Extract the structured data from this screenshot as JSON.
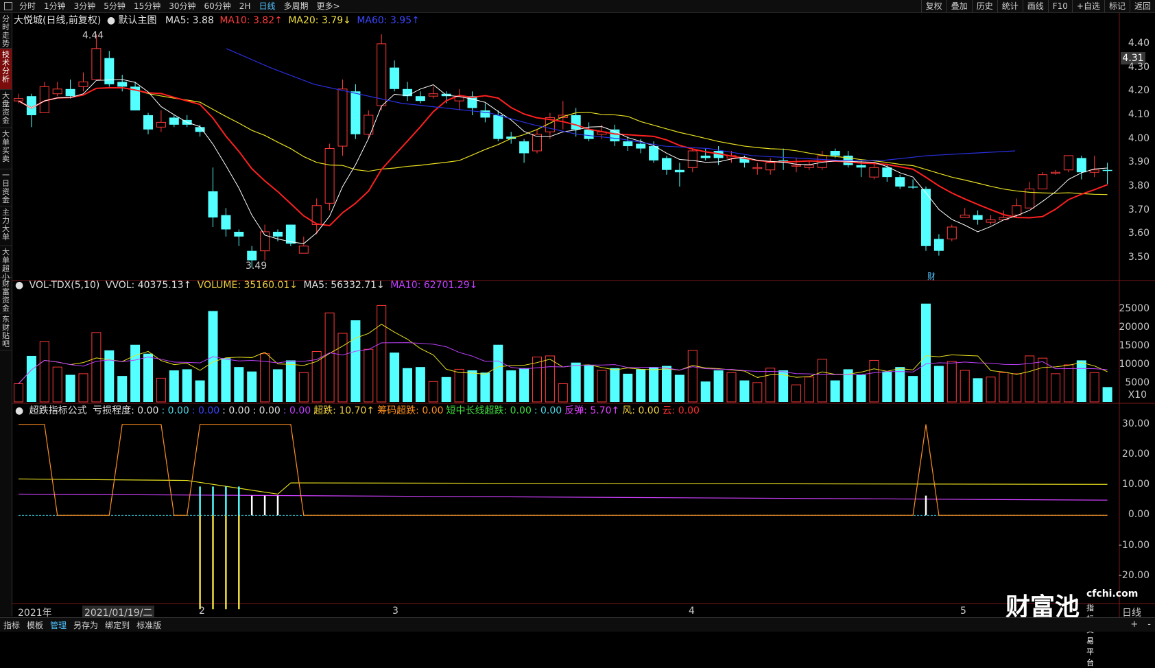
{
  "topbar": {
    "left_items": [
      "分时",
      "1分钟",
      "3分钟",
      "5分钟",
      "15分钟",
      "30分钟",
      "60分钟",
      "2H",
      "日线",
      "多周期",
      "更多>"
    ],
    "active": "日线",
    "right_items": [
      "复权",
      "叠加",
      "历史",
      "统计",
      "画线",
      "F10",
      "+自选",
      "标记",
      "返回"
    ]
  },
  "sidebar": [
    "分时走势",
    "技术分析",
    "大盘资金",
    "大单买卖",
    "一日资金",
    "主力大单",
    "大单超小",
    "财富资金",
    "东财贴吧"
  ],
  "sidebar_active": "技术分析",
  "main": {
    "name": "大悦城(日线,前复权)",
    "template": "默认主图",
    "ma5": "MA5: 3.88",
    "ma10": "MA10: 3.82↑",
    "ma20": "MA20: 3.79↓",
    "ma60": "MA60: 3.95↑",
    "high_label": "4.44",
    "low_label": "3.49",
    "price_tag": "4.31",
    "marker": "财",
    "y_ticks": [
      "4.40",
      "4.30",
      "4.20",
      "4.10",
      "4.00",
      "3.90",
      "3.80",
      "3.70",
      "3.60",
      "3.50"
    ]
  },
  "volume": {
    "title": "VOL-TDX(5,10)",
    "vvol": "VVOL: 40375.13↑",
    "volume": "VOLUME: 35160.01↓",
    "ma5": "MA5: 56332.71↓",
    "ma10": "MA10: 62701.29↓",
    "y_ticks": [
      "25000",
      "20000",
      "15000",
      "10000",
      "5000"
    ],
    "unit": "X10"
  },
  "indicator": {
    "title": "超跌指标公式",
    "parts": [
      {
        "text": "亏损程度: 0.00",
        "color": "#e0e0e0"
      },
      {
        "text": ": 0.00",
        "color": "#4fd8e8"
      },
      {
        "text": ": 0.00",
        "color": "#3a46ff"
      },
      {
        "text": ": 0.00",
        "color": "#e0e0e0"
      },
      {
        "text": ": 0.00",
        "color": "#e0e0e0"
      },
      {
        "text": ": 0.00",
        "color": "#c040ff"
      },
      {
        "text": "超跌: 10.70↑",
        "color": "#f0d040"
      },
      {
        "text": "筹码超跌: 0.00",
        "color": "#ff9020"
      },
      {
        "text": "短中长线超跌: 0.00",
        "color": "#40e040"
      },
      {
        "text": ": 0.00",
        "color": "#4fd8e8"
      },
      {
        "text": "反弹: 5.70↑",
        "color": "#e040ff"
      },
      {
        "text": "风: 0.00",
        "color": "#f0d040"
      },
      {
        "text": "云: 0.00",
        "color": "#ff3030"
      }
    ],
    "y_ticks": [
      "30.00",
      "20.00",
      "10.00",
      "0.00",
      "-10.00",
      "-20.00"
    ]
  },
  "dates": {
    "year": "2021年",
    "cursor": "2021/01/19/二",
    "m2": "2",
    "m3": "3",
    "m4": "4",
    "m5": "5",
    "label": "日线"
  },
  "bottombar": {
    "items": [
      "指标",
      "模板",
      "管理",
      "另存为",
      "绑定到",
      "标准版"
    ],
    "active": "管理",
    "right": [
      "+",
      "-"
    ]
  },
  "logo": {
    "brand": "财富池",
    "domain": "cfchi.com",
    "slogan": "指标交易平台"
  },
  "colors": {
    "up": "#ff3a3a",
    "down": "#54ffff",
    "ma5": "#ffffff",
    "ma10": "#ff2020",
    "ma20": "#e8e020",
    "ma60": "#2a30e0"
  },
  "chart_data": {
    "type": "candlestick",
    "candles": [
      [
        4.17,
        4.16,
        4.19,
        4.15,
        0
      ],
      [
        4.18,
        4.1,
        4.19,
        4.05,
        1
      ],
      [
        4.11,
        4.22,
        4.24,
        4.11,
        0
      ],
      [
        4.19,
        4.21,
        4.24,
        4.18,
        0
      ],
      [
        4.21,
        4.18,
        4.25,
        4.17,
        1
      ],
      [
        4.22,
        4.24,
        4.28,
        4.2,
        0
      ],
      [
        4.25,
        4.38,
        4.44,
        4.25,
        0
      ],
      [
        4.34,
        4.23,
        4.37,
        4.22,
        1
      ],
      [
        4.24,
        4.22,
        4.27,
        4.2,
        1
      ],
      [
        4.22,
        4.12,
        4.24,
        4.12,
        1
      ],
      [
        4.1,
        4.04,
        4.11,
        4.02,
        1
      ],
      [
        4.05,
        4.07,
        4.12,
        4.03,
        0
      ],
      [
        4.09,
        4.06,
        4.1,
        4.05,
        1
      ],
      [
        4.08,
        4.06,
        4.1,
        4.05,
        1
      ],
      [
        4.05,
        4.03,
        4.06,
        4.01,
        1
      ],
      [
        3.78,
        3.67,
        3.88,
        3.63,
        1
      ],
      [
        3.68,
        3.62,
        3.71,
        3.59,
        1
      ],
      [
        3.61,
        3.59,
        3.62,
        3.55,
        1
      ],
      [
        3.53,
        3.49,
        3.55,
        3.46,
        1
      ],
      [
        3.53,
        3.61,
        3.64,
        3.49,
        0
      ],
      [
        3.61,
        3.59,
        3.62,
        3.57,
        1
      ],
      [
        3.64,
        3.56,
        3.64,
        3.55,
        1
      ],
      [
        3.52,
        3.55,
        3.59,
        3.52,
        0
      ],
      [
        3.64,
        3.72,
        3.75,
        3.6,
        0
      ],
      [
        3.73,
        3.96,
        3.98,
        3.7,
        0
      ],
      [
        3.97,
        4.21,
        4.25,
        3.93,
        0
      ],
      [
        4.2,
        4.02,
        4.23,
        4.0,
        1
      ],
      [
        4.02,
        4.1,
        4.12,
        4.0,
        0
      ],
      [
        4.14,
        4.4,
        4.44,
        4.12,
        0
      ],
      [
        4.3,
        4.21,
        4.33,
        4.2,
        1
      ],
      [
        4.21,
        4.18,
        4.24,
        4.16,
        1
      ],
      [
        4.18,
        4.16,
        4.2,
        4.15,
        1
      ],
      [
        4.18,
        4.19,
        4.22,
        4.17,
        0
      ],
      [
        4.19,
        4.18,
        4.2,
        4.15,
        1
      ],
      [
        4.16,
        4.18,
        4.21,
        4.12,
        0
      ],
      [
        4.18,
        4.13,
        4.2,
        4.1,
        1
      ],
      [
        4.12,
        4.09,
        4.15,
        4.07,
        1
      ],
      [
        4.1,
        4.0,
        4.12,
        3.99,
        1
      ],
      [
        4.01,
        4.0,
        4.03,
        3.98,
        1
      ],
      [
        3.99,
        3.94,
        4.0,
        3.9,
        1
      ],
      [
        3.95,
        4.02,
        4.04,
        3.94,
        0
      ],
      [
        4.03,
        4.09,
        4.11,
        4.0,
        0
      ],
      [
        4.09,
        4.1,
        4.16,
        4.04,
        0
      ],
      [
        4.1,
        4.04,
        4.13,
        4.01,
        1
      ],
      [
        4.04,
        4.0,
        4.07,
        3.99,
        1
      ],
      [
        4.02,
        4.03,
        4.06,
        4.0,
        0
      ],
      [
        4.04,
        3.99,
        4.06,
        3.97,
        1
      ],
      [
        3.99,
        3.97,
        4.01,
        3.95,
        1
      ],
      [
        3.98,
        3.96,
        4.0,
        3.94,
        1
      ],
      [
        3.97,
        3.91,
        3.99,
        3.9,
        1
      ],
      [
        3.92,
        3.87,
        3.93,
        3.85,
        1
      ],
      [
        3.87,
        3.86,
        3.9,
        3.8,
        1
      ],
      [
        3.88,
        3.95,
        3.96,
        3.86,
        0
      ],
      [
        3.93,
        3.92,
        3.96,
        3.91,
        1
      ],
      [
        3.95,
        3.92,
        3.97,
        3.89,
        1
      ],
      [
        3.92,
        3.93,
        3.95,
        3.9,
        0
      ],
      [
        3.92,
        3.9,
        3.93,
        3.88,
        1
      ],
      [
        3.88,
        3.88,
        3.9,
        3.85,
        0
      ],
      [
        3.87,
        3.9,
        3.92,
        3.85,
        0
      ],
      [
        3.91,
        3.9,
        3.96,
        3.87,
        1
      ],
      [
        3.89,
        3.89,
        3.92,
        3.86,
        0
      ],
      [
        3.88,
        3.89,
        3.91,
        3.87,
        0
      ],
      [
        3.88,
        3.93,
        3.95,
        3.87,
        0
      ],
      [
        3.95,
        3.93,
        3.96,
        3.92,
        1
      ],
      [
        3.93,
        3.89,
        3.95,
        3.88,
        1
      ],
      [
        3.89,
        3.88,
        3.91,
        3.84,
        1
      ],
      [
        3.84,
        3.88,
        3.9,
        3.83,
        0
      ],
      [
        3.88,
        3.84,
        3.89,
        3.82,
        1
      ],
      [
        3.84,
        3.8,
        3.85,
        3.79,
        1
      ],
      [
        3.8,
        3.8,
        3.83,
        3.79,
        1
      ],
      [
        3.79,
        3.55,
        3.8,
        3.53,
        1
      ],
      [
        3.58,
        3.53,
        3.6,
        3.51,
        1
      ],
      [
        3.58,
        3.63,
        3.64,
        3.57,
        0
      ],
      [
        3.67,
        3.68,
        3.71,
        3.67,
        0
      ],
      [
        3.68,
        3.66,
        3.7,
        3.64,
        1
      ],
      [
        3.65,
        3.66,
        3.68,
        3.64,
        0
      ],
      [
        3.66,
        3.67,
        3.7,
        3.66,
        0
      ],
      [
        3.68,
        3.72,
        3.75,
        3.67,
        0
      ],
      [
        3.71,
        3.79,
        3.82,
        3.71,
        0
      ],
      [
        3.79,
        3.85,
        3.86,
        3.79,
        0
      ],
      [
        3.86,
        3.86,
        3.87,
        3.85,
        0
      ],
      [
        3.87,
        3.93,
        3.93,
        3.86,
        0
      ],
      [
        3.92,
        3.86,
        3.93,
        3.83,
        1
      ],
      [
        3.86,
        3.87,
        3.93,
        3.84,
        0
      ],
      [
        3.87,
        3.87,
        3.9,
        3.81,
        1
      ]
    ],
    "ma60": [
      4.38,
      4.3,
      4.23,
      4.19,
      4.15,
      4.13,
      4.11,
      4.06,
      4.02,
      4.0,
      3.97,
      3.96,
      3.93,
      3.92,
      3.91,
      3.91,
      3.93,
      3.94,
      3.95
    ]
  }
}
